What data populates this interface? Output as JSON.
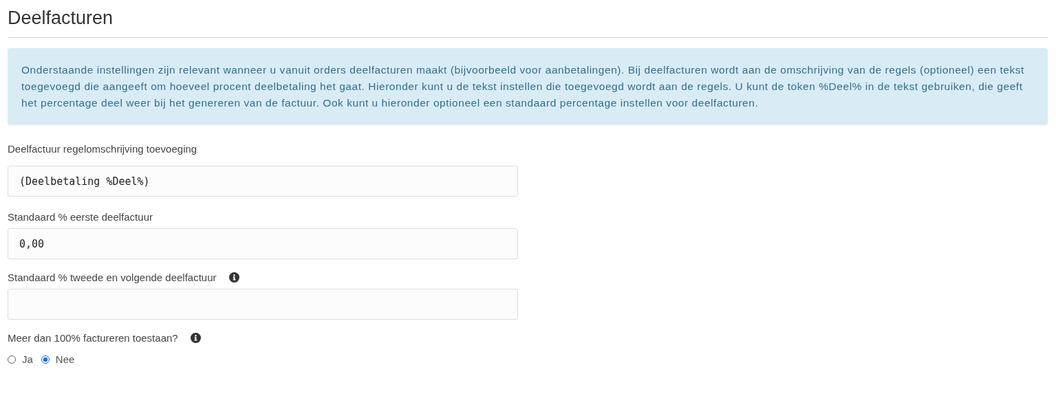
{
  "title": "Deelfacturen",
  "notice": "Onderstaande instellingen zijn relevant wanneer u vanuit orders deelfacturen maakt (bijvoorbeeld voor aanbetalingen). Bij deelfacturen wordt aan de omschrijving van de regels (optioneel) een tekst toegevoegd die aangeeft om hoeveel procent deelbetaling het gaat. Hieronder kunt u de tekst instellen die toegevoegd wordt aan de regels. U kunt de token %Deel% in de tekst gebruiken, die geeft het percentage deel weer bij het genereren van de factuur. Ook kunt u hieronder optioneel een standaard percentage instellen voor deelfacturen.",
  "fields": [
    {
      "kind": "text",
      "label": "Deelfactuur regelomschrijving toevoeging",
      "info": false,
      "value": "(Deelbetaling %Deel%)"
    },
    {
      "kind": "text",
      "label": "Standaard % eerste deelfactuur",
      "info": false,
      "value": "0,00"
    },
    {
      "kind": "text",
      "label": "Standaard % tweede en volgende deelfactuur",
      "info": true
    },
    {
      "kind": "radio",
      "label": "Meer dan 100% factureren toestaan?",
      "info": true,
      "options": [
        {
          "label": "Ja",
          "selected": false
        },
        {
          "label": "Nee",
          "selected": true
        }
      ]
    }
  ]
}
